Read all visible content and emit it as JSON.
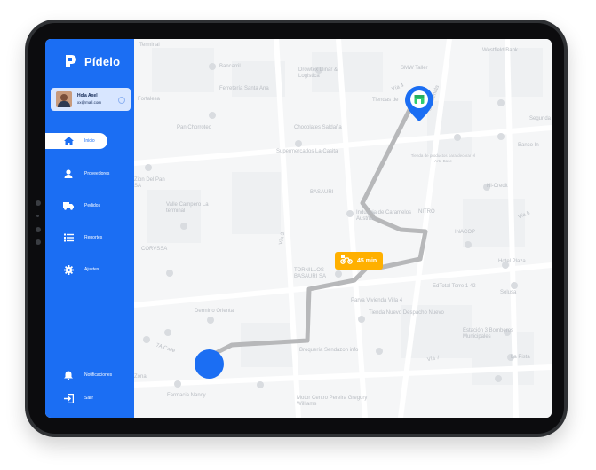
{
  "colors": {
    "brand_blue": "#1b6ef3",
    "route_gray": "#b7b8ba",
    "eta_orange": "#ffb000",
    "destination_green": "#2ecc71"
  },
  "app": {
    "brand_name": "Pídelo"
  },
  "user": {
    "name": "Hola Axel",
    "email": "xx@mail.com"
  },
  "sidebar": {
    "items": [
      {
        "label": "Inicio",
        "icon": "home-icon"
      },
      {
        "label": "Proveedores",
        "icon": "user-icon"
      },
      {
        "label": "Pedidos",
        "icon": "truck-icon"
      },
      {
        "label": "Reportes",
        "icon": "list-icon"
      },
      {
        "label": "Ajustes",
        "icon": "gear-icon"
      }
    ],
    "bottom": [
      {
        "label": "Notificaciones",
        "icon": "bell-icon"
      },
      {
        "label": "Salir",
        "icon": "logout-icon"
      }
    ]
  },
  "map": {
    "eta": "45 min",
    "labels": [
      "Terminal",
      "Bancarril",
      "Drowtex Llinar & Logistica",
      "SMW Taller",
      "Westfield Bank",
      "Ferretería Santa Ana",
      "Fortalesa",
      "Tiendas de",
      "Pan Chorroteo",
      "Chocolates Saldaña",
      "Segunda",
      "Tienda de productos para decorar el Arte Base",
      "Supermercados La Casita",
      "Banco In",
      "Zion Del Pan SA",
      "Valle Campero La terminal",
      "BASAURI",
      "Industria de Caramelos Austrias",
      "NITRO",
      "Hi-Credit",
      "CORVSSA",
      "INACOP",
      "Hotel Plaza",
      "TORNILLOS BASAURI SA",
      "EdTotal Torre 1 42",
      "Solusa",
      "Dermino Oriental",
      "Parva Vivienda Villa 4",
      "Tienda Nuevo Despacho Nuevo",
      "Estación 3 Bomberos Municipales",
      "Broquería Sendazon info",
      "La Pista",
      "Zona",
      "Farmacia Nancy",
      "Motor Centro Pereira Gregory Williams",
      "6A Avenida",
      "7A Calle",
      "Vía 4",
      "Vía 3",
      "Vía 5",
      "Vía 7"
    ]
  }
}
